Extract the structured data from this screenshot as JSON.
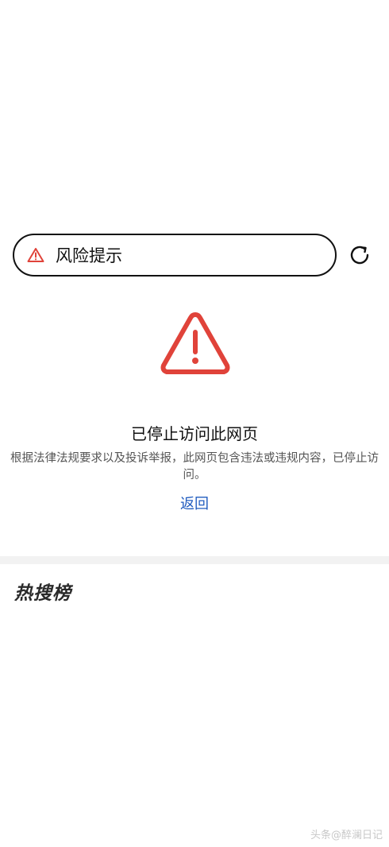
{
  "address_bar": {
    "title": "风险提示",
    "warning_icon": "warning-triangle-icon",
    "refresh_icon": "refresh-icon"
  },
  "notice": {
    "warning_icon": "warning-triangle-icon",
    "headline": "已停止访问此网页",
    "description": "根据法律法规要求以及投诉举报，此网页包含违法或违规内容，已停止访问。",
    "back_label": "返回"
  },
  "hot_list": {
    "title": "热搜榜"
  },
  "watermark": "头条@醉澜日记",
  "colors": {
    "warning": "#e0433a",
    "link": "#1f5bbf",
    "divider": "#f2f2f2"
  }
}
